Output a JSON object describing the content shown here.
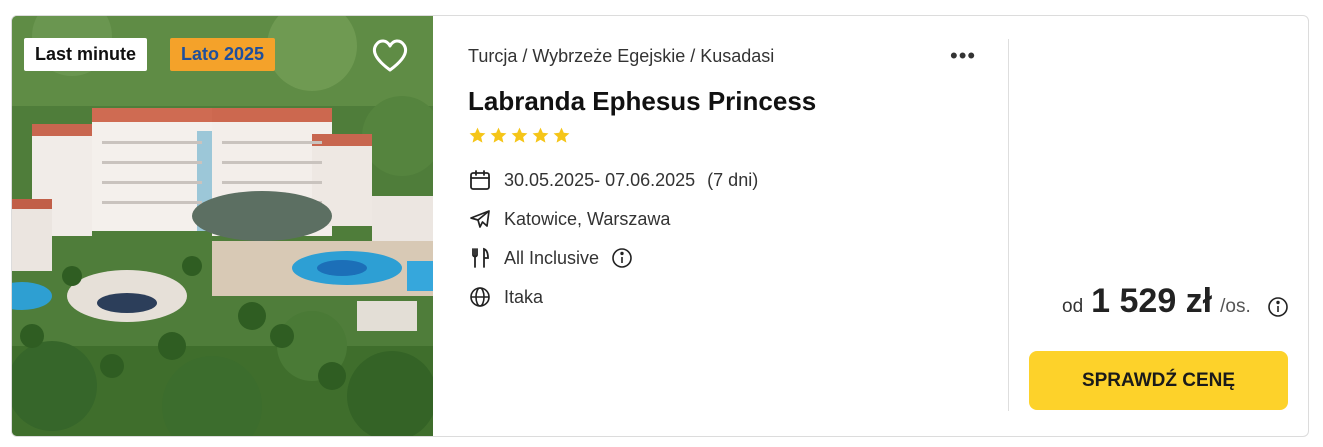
{
  "offer": {
    "badges": {
      "last_minute": "Last minute",
      "season": "Lato 2025"
    },
    "breadcrumb": "Turcja / Wybrzeże Egejskie / Kusadasi",
    "more_label": "•••",
    "hotel_name": "Labranda Ephesus Princess",
    "rating_stars": 5,
    "dates": "30.05.2025- 07.06.2025",
    "duration": "(7 dni)",
    "departure": "Katowice, Warszawa",
    "board": "All Inclusive",
    "operator": "Itaka",
    "price": {
      "prefix": "od",
      "amount": "1 529 zł",
      "suffix": "/os."
    },
    "cta_label": "SPRAWDŹ CENĘ"
  },
  "colors": {
    "star": "#f5c518",
    "cta": "#fdd22a",
    "badge_season_bg": "#f4a22a",
    "badge_season_text": "#1f4f9c"
  },
  "icons": [
    "heart-icon",
    "more-dots-icon",
    "calendar-icon",
    "plane-icon",
    "cutlery-icon",
    "info-icon",
    "globe-icon",
    "star-icon"
  ]
}
